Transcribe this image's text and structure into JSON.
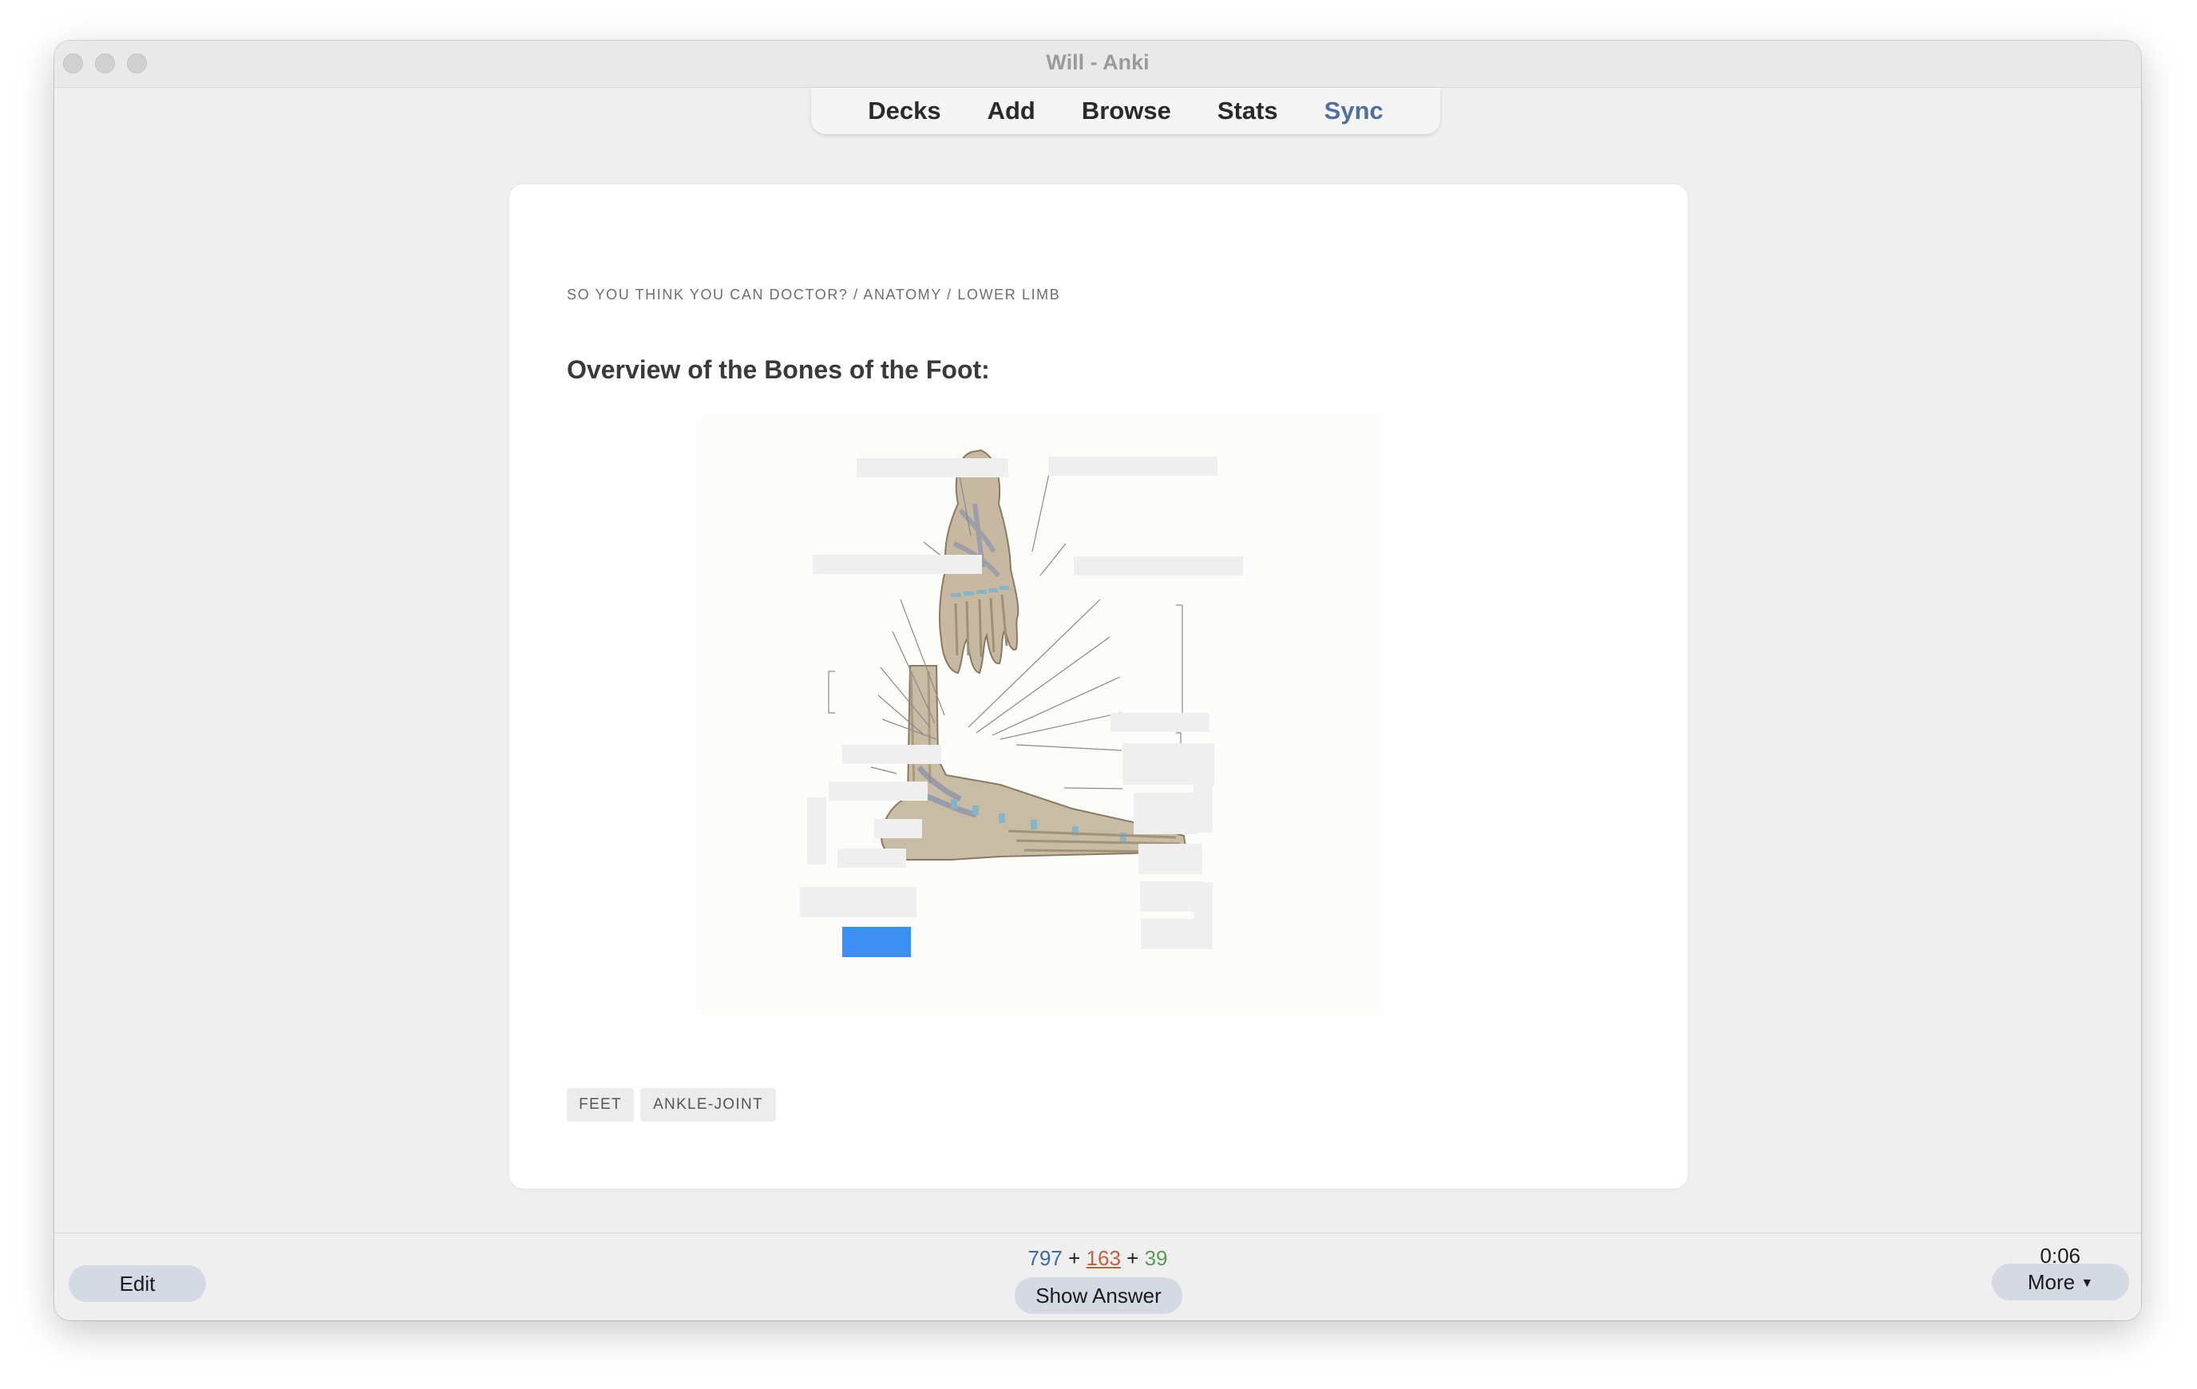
{
  "window": {
    "title": "Will - Anki"
  },
  "toolbar": {
    "items": [
      "Decks",
      "Add",
      "Browse",
      "Stats",
      "Sync"
    ]
  },
  "card": {
    "breadcrumb": "SO YOU THINK YOU CAN DOCTOR? / ANATOMY / LOWER LIMB",
    "title": "Overview of the Bones of the Foot:",
    "tags": [
      "FEET",
      "ANKLE-JOINT"
    ]
  },
  "bottom": {
    "edit_label": "Edit",
    "counts": {
      "new": "797",
      "learning": "163",
      "review": "39"
    },
    "show_answer_label": "Show Answer",
    "timer": "0:06",
    "more_label": "More"
  },
  "colors": {
    "sync_accent": "#4f6f9d",
    "new_count": "#3e67a5",
    "learning_count": "#c0623c",
    "review_count": "#5d9b52",
    "active_occlusion": "#3d8ff2"
  }
}
